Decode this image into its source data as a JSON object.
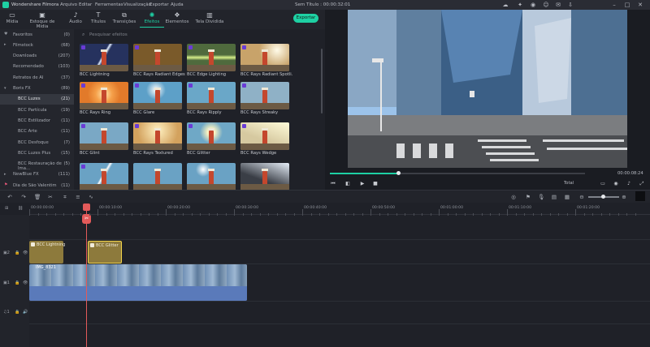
{
  "app": {
    "name": "Wondershare Filmora",
    "menu": [
      "Arquivo",
      "Editar",
      "Ferramentas",
      "Visualização",
      "Exportar",
      "Ajuda"
    ],
    "window_title": "Sem Título : 00:00:32:01",
    "export_label": "Exportar"
  },
  "tabs": [
    {
      "label": "Mídia",
      "icon": "folder-icon"
    },
    {
      "label": "Estoque de Mídia",
      "icon": "stock-media-icon"
    },
    {
      "label": "Áudio",
      "icon": "music-note-icon"
    },
    {
      "label": "Títulos",
      "icon": "text-t-icon"
    },
    {
      "label": "Transições",
      "icon": "transition-icon"
    },
    {
      "label": "Efeitos",
      "icon": "effects-icon"
    },
    {
      "label": "Elementos",
      "icon": "elements-icon"
    },
    {
      "label": "Tela Dividida",
      "icon": "split-screen-icon"
    }
  ],
  "active_tab": "Efeitos",
  "categories": [
    {
      "label": "Favoritos",
      "count": "(0)",
      "icon": "heart-icon"
    },
    {
      "label": "Filmstock",
      "count": "(68)",
      "icon": "chevron-right-icon"
    },
    {
      "label": "Downloads",
      "count": "(207)"
    },
    {
      "label": "Recomendado",
      "count": "(103)"
    },
    {
      "label": "Retratos de AI",
      "count": "(37)"
    },
    {
      "label": "Boris FX",
      "count": "(89)",
      "icon": "chevron-down-icon"
    },
    {
      "label": "BCC Luzes",
      "count": "(21)",
      "selected": true,
      "sub": true
    },
    {
      "label": "BCC Partícula",
      "count": "(19)",
      "sub": true
    },
    {
      "label": "BCC Estilizador",
      "count": "(11)",
      "sub": true
    },
    {
      "label": "BCC Arte",
      "count": "(11)",
      "sub": true
    },
    {
      "label": "BCC Desfoque",
      "count": "(7)",
      "sub": true
    },
    {
      "label": "BCC Luzes Plus",
      "count": "(15)",
      "sub": true
    },
    {
      "label": "BCC Restauração de Ima...",
      "count": "(5)",
      "sub": true
    },
    {
      "label": "NewBlue FX",
      "count": "(111)",
      "icon": "chevron-right-icon"
    },
    {
      "label": "Dia de São Valentim",
      "count": "(11)",
      "icon": "flag-icon"
    }
  ],
  "search": {
    "placeholder": "Pesquisar efeitos"
  },
  "effects": [
    {
      "name": "BCC Lightning",
      "sky": "#26325e",
      "fx": "lightning"
    },
    {
      "name": "BCC Rays Radiant Edges",
      "sky": "#7a5a2a",
      "fx": "radiant"
    },
    {
      "name": "BCC Edge Lighting",
      "sky": "#4f6a3d",
      "fx": "edge"
    },
    {
      "name": "BCC Rays Radiant Spotli...",
      "sky": "#c8a36a",
      "fx": "spot"
    },
    {
      "name": "BCC Rays Ring",
      "sky": "#e27a2a",
      "fx": "ring"
    },
    {
      "name": "BCC Glare",
      "sky": "#5da0c8",
      "fx": "glare"
    },
    {
      "name": "BCC Rays Ripply",
      "sky": "#6aa7c8",
      "fx": "ripply"
    },
    {
      "name": "BCC Rays Streaky",
      "sky": "#8fb1c6",
      "fx": "streaky"
    },
    {
      "name": "BCC Glint",
      "sky": "#7aa8c5",
      "fx": "glint"
    },
    {
      "name": "BCC Rays Textured",
      "sky": "#d3a25e",
      "fx": "textured"
    },
    {
      "name": "BCC Glitter",
      "sky": "#6fa8c6",
      "fx": "glitter"
    },
    {
      "name": "BCC Rays Wedge",
      "sky": "#d6c9a0",
      "fx": "wedge"
    },
    {
      "name": "",
      "sky": "#6aa2c4",
      "fx": "beam"
    },
    {
      "name": "",
      "sky": "#6aa2c4",
      "fx": "plain"
    },
    {
      "name": "",
      "sky": "#6aa2c4",
      "fx": "sun"
    },
    {
      "name": "",
      "sky": "#3a3e46",
      "fx": "wedge2"
    }
  ],
  "preview": {
    "timecode": "00:00:08:24",
    "quality": "Total",
    "controls": [
      "skip-back-icon",
      "step-back-icon",
      "play-icon",
      "stop-icon"
    ],
    "progress": 0.27
  },
  "timeline": {
    "ruler": [
      "00:00:00:00",
      "00:00:10:00",
      "00:00:20:00",
      "00:00:30:00",
      "00:00:40:00",
      "00:00:50:00",
      "00:01:00:00",
      "00:01:10:00",
      "00:01:20:00"
    ],
    "tracks": [
      {
        "id": "2",
        "type": "effect"
      },
      {
        "id": "1",
        "type": "video"
      },
      {
        "id": "1",
        "type": "audio"
      }
    ],
    "fx_clips": [
      "BCC Lightning",
      "BCC Glitter"
    ],
    "video_clip": "IMG_8321"
  }
}
